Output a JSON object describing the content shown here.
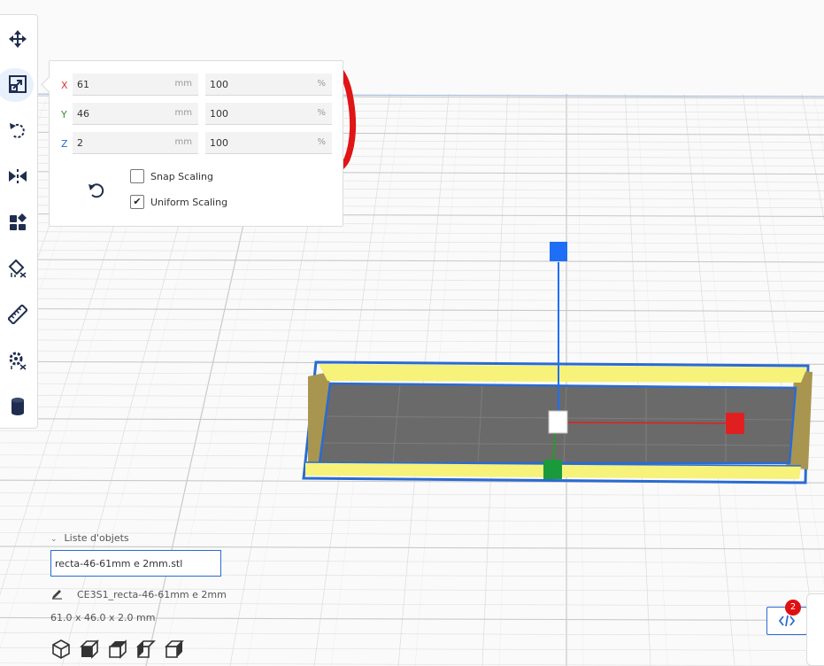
{
  "toolbar": {
    "tools": [
      {
        "name": "move-icon"
      },
      {
        "name": "scale-icon",
        "active": true
      },
      {
        "name": "rotate-icon"
      },
      {
        "name": "mirror-icon"
      },
      {
        "name": "per-model-settings-icon"
      },
      {
        "name": "support-blocker-icon"
      },
      {
        "name": "measure-icon"
      },
      {
        "name": "settings-blocker-icon"
      },
      {
        "name": "cylinder-icon"
      }
    ]
  },
  "scale_panel": {
    "x": {
      "label": "X",
      "mm": "61",
      "mm_unit": "mm",
      "percent": "100",
      "percent_unit": "%",
      "color": "#d33"
    },
    "y": {
      "label": "Y",
      "mm": "46",
      "mm_unit": "mm",
      "percent": "100",
      "percent_unit": "%",
      "color": "#2a9a2a"
    },
    "z": {
      "label": "Z",
      "mm": "2",
      "mm_unit": "mm",
      "percent": "100",
      "percent_unit": "%",
      "color": "#2a6bd1"
    },
    "snap_scaling": {
      "label": "Snap Scaling",
      "checked": false
    },
    "uniform_scaling": {
      "label": "Uniform Scaling",
      "checked": true,
      "check_mark": "✔"
    }
  },
  "objects": {
    "header": "Liste d'objets",
    "chevron": "⌄",
    "selected_file": "recta-46-61mm e 2mm.stl",
    "object_name": "CE3S1_recta-46-61mm e 2mm",
    "dimensions": "61.0 x 46.0 x 2.0 mm"
  },
  "notifications": {
    "badge_count": "2"
  },
  "colors": {
    "accent": "#2a6bd1",
    "model_yellow": "#f6f27a",
    "model_gold": "#a8954f",
    "annotation_red": "#e01515"
  }
}
